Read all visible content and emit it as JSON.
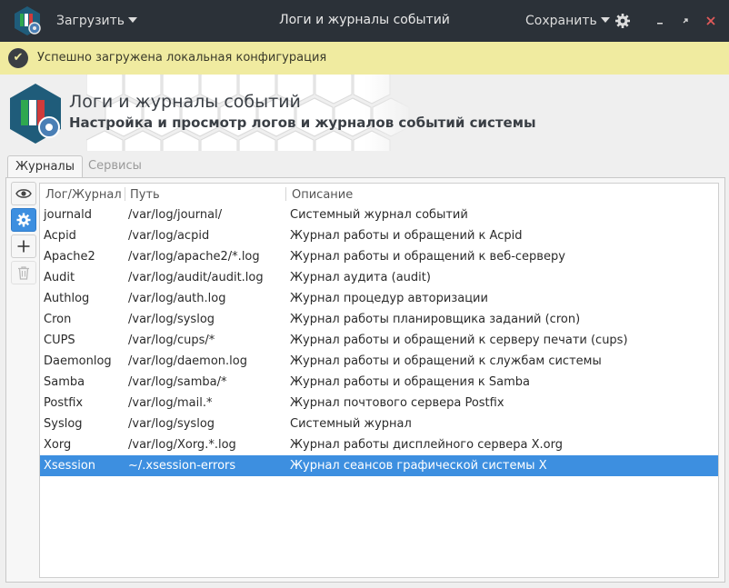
{
  "titlebar": {
    "load_menu": "Загрузить",
    "title": "Логи и журналы событий",
    "save_menu": "Сохранить"
  },
  "notification": {
    "text": "Успешно загружена локальная конфигурация"
  },
  "header": {
    "title": "Логи и журналы событий",
    "subtitle": "Настройка и просмотр логов и журналов событий системы"
  },
  "tabs": [
    {
      "label": "Журналы",
      "active": true
    },
    {
      "label": "Сервисы",
      "active": false
    }
  ],
  "toolbar": {
    "icons": [
      "eye-icon",
      "gear-icon",
      "plus-icon",
      "trash-icon"
    ]
  },
  "table": {
    "columns": [
      "Лог/Журнал",
      "Путь",
      "Описание"
    ],
    "rows": [
      {
        "name": "journald",
        "path": "/var/log/journal/",
        "desc": "Системный журнал событий"
      },
      {
        "name": "Acpid",
        "path": "/var/log/acpid",
        "desc": "Журнал работы и обращений к Acpid"
      },
      {
        "name": "Apache2",
        "path": "/var/log/apache2/*.log",
        "desc": "Журнал работы и обращений к веб-серверу"
      },
      {
        "name": "Audit",
        "path": "/var/log/audit/audit.log",
        "desc": "Журнал аудита (audit)"
      },
      {
        "name": "Authlog",
        "path": "/var/log/auth.log",
        "desc": "Журнал процедур авторизации"
      },
      {
        "name": "Cron",
        "path": "/var/log/syslog",
        "desc": "Журнал работы планировщика заданий (cron)"
      },
      {
        "name": "CUPS",
        "path": "/var/log/cups/*",
        "desc": "Журнал работы и обращений к серверу печати (cups)"
      },
      {
        "name": "Daemonlog",
        "path": "/var/log/daemon.log",
        "desc": "Журнал работы и обращений к службам системы"
      },
      {
        "name": "Samba",
        "path": "/var/log/samba/*",
        "desc": "Журнал работы и обращения к Samba"
      },
      {
        "name": "Postfix",
        "path": "/var/log/mail.*",
        "desc": "Журнал почтового сервера Postfix"
      },
      {
        "name": "Syslog",
        "path": "/var/log/syslog",
        "desc": "Системный журнал"
      },
      {
        "name": "Xorg",
        "path": "/var/log/Xorg.*.log",
        "desc": "Журнал работы дисплейного сервера X.org"
      },
      {
        "name": "Xsession",
        "path": "~/.xsession-errors",
        "desc": "Журнал сеансов графической системы X",
        "selected": true
      }
    ]
  },
  "colors": {
    "titlebar": "#2b3138",
    "notification": "#f0eba0",
    "selection": "#3d8fe0"
  }
}
